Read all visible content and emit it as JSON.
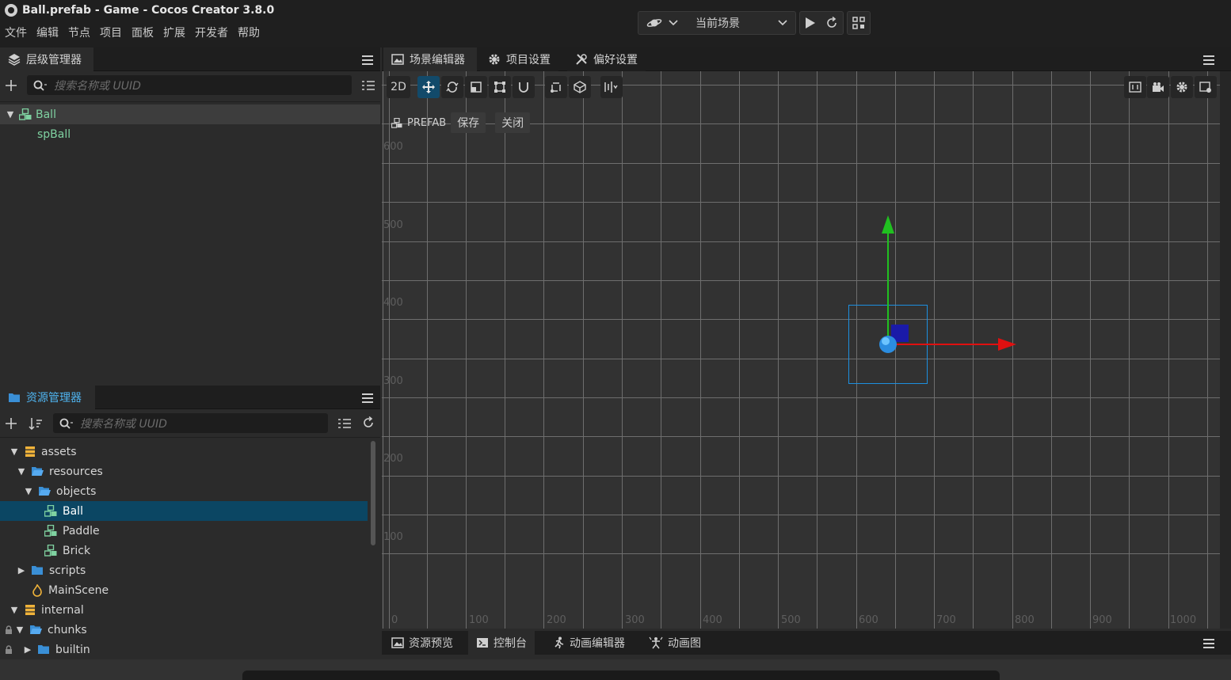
{
  "window": {
    "title": "Ball.prefab - Game - Cocos Creator 3.8.0"
  },
  "menu": [
    "文件",
    "编辑",
    "节点",
    "项目",
    "面板",
    "扩展",
    "开发者",
    "帮助"
  ],
  "toolbar": {
    "scene_select": "当前场景"
  },
  "hierarchy": {
    "tab_label": "层级管理器",
    "search_placeholder": "搜索名称或 UUID",
    "nodes": [
      {
        "label": "Ball",
        "type": "prefab",
        "expanded": true
      },
      {
        "label": "spBall",
        "type": "prefab-child"
      }
    ]
  },
  "assets": {
    "tab_label": "资源管理器",
    "search_placeholder": "搜索名称或 UUID",
    "items": [
      {
        "label": "assets",
        "icon": "db-icon"
      },
      {
        "label": "resources",
        "icon": "folder-open-icon"
      },
      {
        "label": "objects",
        "icon": "folder-open-icon"
      },
      {
        "label": "Ball",
        "icon": "prefab-icon",
        "selected": true
      },
      {
        "label": "Paddle",
        "icon": "prefab-icon"
      },
      {
        "label": "Brick",
        "icon": "prefab-icon"
      },
      {
        "label": "scripts",
        "icon": "folder-icon"
      },
      {
        "label": "MainScene",
        "icon": "scene-icon"
      },
      {
        "label": "internal",
        "icon": "db-icon"
      },
      {
        "label": "chunks",
        "icon": "folder-open-icon",
        "locked": true
      },
      {
        "label": "builtin",
        "icon": "folder-icon",
        "locked": true
      }
    ]
  },
  "editor_tabs": [
    {
      "label": "场景编辑器",
      "icon": "scene-editor-icon",
      "active": true
    },
    {
      "label": "项目设置",
      "icon": "gear-icon"
    },
    {
      "label": "偏好设置",
      "icon": "wrench-icon"
    }
  ],
  "scene": {
    "mode_label": "2D",
    "prefab_bar": {
      "label": "PREFAB",
      "save": "保存",
      "close": "关闭"
    },
    "y_labels": [
      "600",
      "500",
      "400",
      "300",
      "200",
      "100"
    ],
    "x_labels": [
      "0",
      "100",
      "200",
      "300",
      "400",
      "500",
      "600",
      "700",
      "800",
      "900",
      "1000"
    ]
  },
  "bottom_tabs": [
    {
      "label": "资源预览",
      "active": false
    },
    {
      "label": "控制台",
      "active": true
    },
    {
      "label": "动画编辑器",
      "active": false
    },
    {
      "label": "动画图",
      "active": false
    }
  ],
  "colors": {
    "accent": "#0b4663",
    "prefab": "#7fd2a1",
    "gizmo_x": "#e01010",
    "gizmo_y": "#20c020"
  }
}
